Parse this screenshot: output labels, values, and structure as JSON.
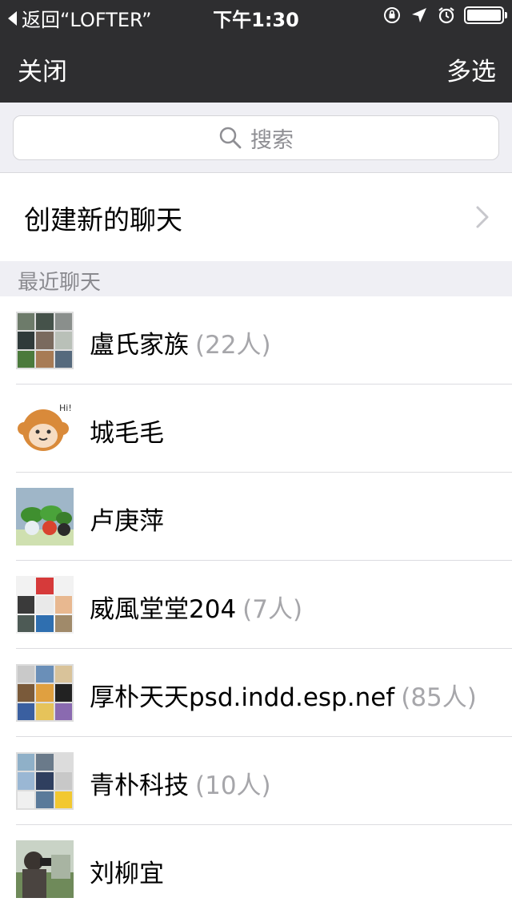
{
  "status_bar": {
    "back_label": "返回“LOFTER”",
    "time": "下午1:30"
  },
  "nav": {
    "close_label": "关闭",
    "multiselect_label": "多选"
  },
  "search": {
    "placeholder": "搜索"
  },
  "create_chat": {
    "label": "创建新的聊天"
  },
  "section": {
    "recent_label": "最近聊天"
  },
  "chats": [
    {
      "name": "盧氏家族",
      "count": "(22人)"
    },
    {
      "name": "城毛毛",
      "count": ""
    },
    {
      "name": "卢庚萍",
      "count": ""
    },
    {
      "name": "威風堂堂204",
      "count": "(7人)"
    },
    {
      "name": "厚朴天天psd.indd.esp.nef",
      "count": "(85人)"
    },
    {
      "name": "青朴科技",
      "count": "(10人)"
    },
    {
      "name": "刘柳宜",
      "count": ""
    }
  ],
  "colors": {
    "nav_bg": "#2e2e30",
    "page_bg": "#efeff4",
    "secondary_text": "#8a8a8f"
  }
}
